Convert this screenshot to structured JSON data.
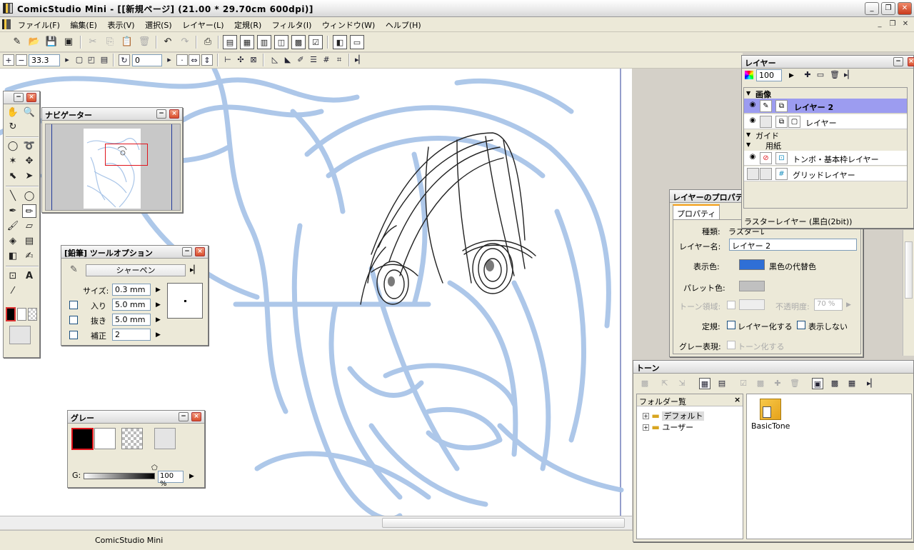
{
  "window": {
    "title": "ComicStudio Mini - [[新規ページ] (21.00 * 29.70cm 600dpi)]",
    "min": "_",
    "max": "❐",
    "close": "✕"
  },
  "menu": [
    "ファイル(F)",
    "編集(E)",
    "表示(V)",
    "選択(S)",
    "レイヤー(L)",
    "定規(R)",
    "フィルタ(I)",
    "ウィンドウ(W)",
    "ヘルプ(H)"
  ],
  "toolbar2": {
    "zoom": "33.3",
    "rotation": "0"
  },
  "status": {
    "text": "ComicStudio Mini"
  },
  "tools_palette": {},
  "navigator": {
    "title": "ナビゲーター"
  },
  "tool_options": {
    "title": "[鉛筆] ツールオプション",
    "preset": "シャーペン",
    "size_label": "サイズ:",
    "size_value": "0.3 mm",
    "in_label": "入り",
    "in_value": "5.0 mm",
    "out_label": "抜き",
    "out_value": "5.0 mm",
    "correction_label": "補正",
    "correction_value": "2"
  },
  "gray": {
    "title": "グレー",
    "g_label": "G:",
    "g_value": "100 %"
  },
  "layers": {
    "title": "レイヤー",
    "opacity": "100",
    "group_image": "画像",
    "group_guide": "ガイド",
    "group_paper": "用紙",
    "rows": [
      "レイヤー 2",
      "レイヤー",
      "トンボ・基本枠レイヤー",
      "グリッドレイヤー"
    ],
    "status": "ラスターレイヤー (黒白(2bit))"
  },
  "props": {
    "title": "レイヤーのプロパティ",
    "tab": "プロパティ",
    "type_label": "種類:",
    "type_value": "ラスターレイヤー",
    "name_label": "レイヤー名:",
    "name_value": "レイヤー 2",
    "display_color_label": "表示色:",
    "display_color_name": "黒色の代替色",
    "palette_color_label": "パレット色:",
    "tone_area_label": "トーン領域:",
    "opacity_label": "不透明度:",
    "opacity_value": "70 %",
    "ruler_label": "定規:",
    "ruler_layer": "レイヤー化する",
    "ruler_hide": "表示しない",
    "gray_label": "グレー表現:",
    "gray_tone": "トーン化する",
    "colors": {
      "display": "#2f6fd6",
      "palette": "#c0c0c0"
    }
  },
  "tone": {
    "title": "トーン",
    "folder_title": "フォルダー覧",
    "folders": [
      "デフォルト",
      "ユーザー"
    ],
    "item": "BasicTone"
  },
  "colors": {
    "sketch_blue": "#a9c5e8",
    "ink": "#222222",
    "selection": "#9c9cf0"
  }
}
